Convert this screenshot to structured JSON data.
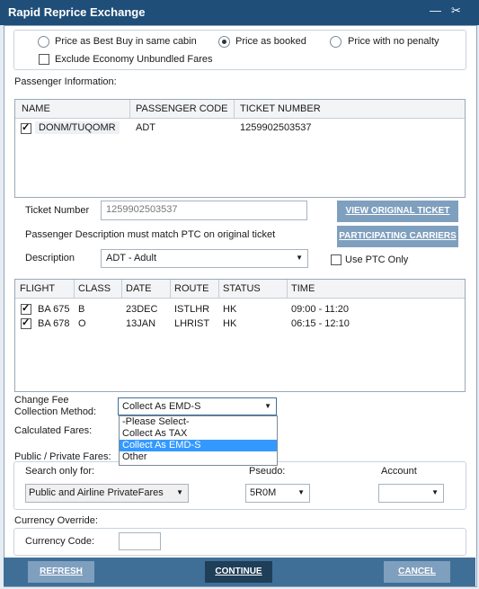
{
  "window": {
    "title": "Rapid Reprice Exchange"
  },
  "pricing": {
    "options": [
      "Price as Best Buy in same cabin",
      "Price as booked",
      "Price with no penalty"
    ],
    "selected_index": 1,
    "exclude_label": "Exclude Economy Unbundled Fares"
  },
  "passenger": {
    "section_label": "Passenger Information:",
    "columns": [
      "NAME",
      "PASSENGER CODE",
      "TICKET NUMBER"
    ],
    "rows": [
      {
        "name": "DONM/TUQOMR",
        "code": "ADT",
        "ticket": "1259902503537"
      }
    ]
  },
  "ticket": {
    "label": "Ticket Number",
    "value": "1259902503537",
    "note": "Passenger Description must match PTC on original ticket",
    "desc_label": "Description",
    "desc_value": "ADT - Adult",
    "view_btn": "VIEW ORIGINAL TICKET",
    "carriers_btn": "PARTICIPATING CARRIERS",
    "ptc_label": "Use PTC Only"
  },
  "flights": {
    "columns": [
      "FLIGHT",
      "CLASS",
      "DATE",
      "ROUTE",
      "STATUS",
      "TIME"
    ],
    "rows": [
      {
        "flight": "BA 675",
        "class": "B",
        "date": "23DEC",
        "route": "ISTLHR",
        "status": "HK",
        "time": "09:00 - 11:20"
      },
      {
        "flight": "BA 678",
        "class": "O",
        "date": "13JAN",
        "route": "LHRIST",
        "status": "HK",
        "time": "06:15 - 12:10"
      }
    ]
  },
  "change_fee": {
    "label_line1": "Change Fee",
    "label_line2": "Collection Method:",
    "selected": "Collect As EMD-S",
    "options": [
      "-Please Select-",
      "Collect As TAX",
      "Collect As EMD-S",
      "Other"
    ],
    "highlighted_index": 2
  },
  "calculated_label": "Calculated Fares:",
  "public_private": {
    "section_label": "Public / Private Fares:",
    "search_label": "Search only for:",
    "search_value": "Public and Airline PrivateFares",
    "pseudo_label": "Pseudo:",
    "pseudo_value": "5R0M",
    "account_label": "Account",
    "account_value": ""
  },
  "currency": {
    "section_label": "Currency Override:",
    "code_label": "Currency Code:",
    "code_value": ""
  },
  "footer": {
    "refresh": "REFRESH",
    "continue": "CONTINUE",
    "cancel": "CANCEL"
  }
}
